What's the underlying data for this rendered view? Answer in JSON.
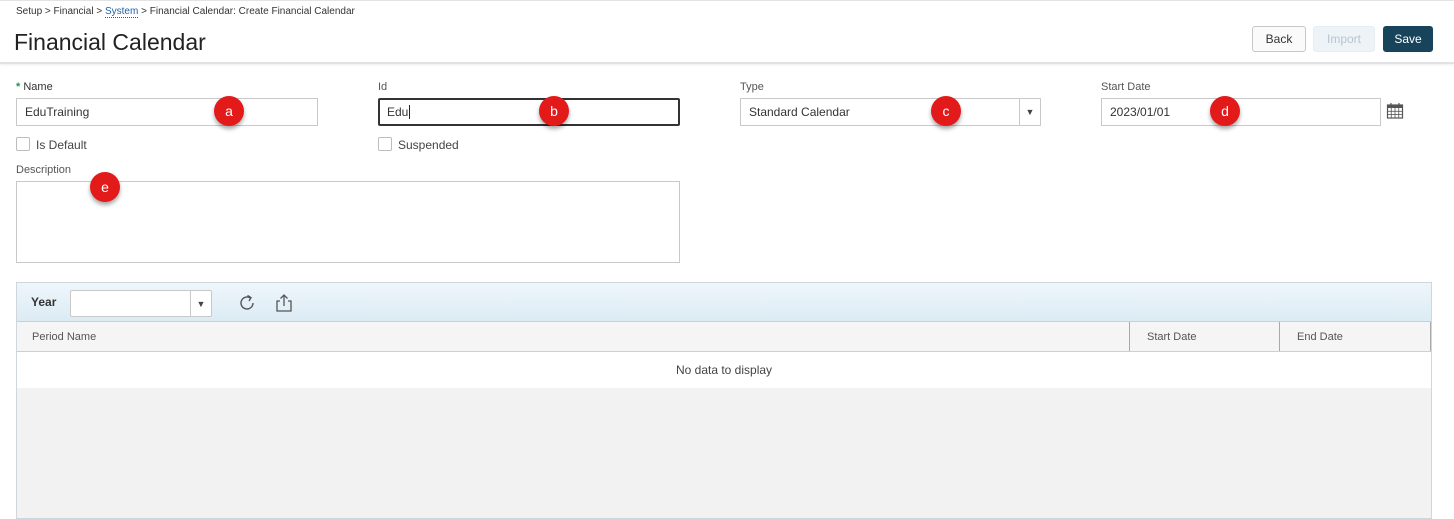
{
  "breadcrumb": {
    "items": [
      "Setup",
      "Financial",
      "System",
      "Financial Calendar: Create Financial Calendar"
    ],
    "separator": ">"
  },
  "page": {
    "title": "Financial Calendar"
  },
  "actions": {
    "back": "Back",
    "import": "Import",
    "save": "Save"
  },
  "form": {
    "name": {
      "required_marker": "*",
      "label": "Name",
      "value": "EduTraining"
    },
    "id": {
      "label": "Id",
      "value": "Edu"
    },
    "type": {
      "label": "Type",
      "value": "Standard Calendar"
    },
    "start_date": {
      "label": "Start Date",
      "value": "2023/01/01"
    },
    "is_default": {
      "label": "Is Default",
      "checked": false
    },
    "suspended": {
      "label": "Suspended",
      "checked": false
    },
    "description": {
      "label": "Description",
      "value": ""
    }
  },
  "callouts": {
    "a": "a",
    "b": "b",
    "c": "c",
    "d": "d",
    "e": "e"
  },
  "grid": {
    "year_label": "Year",
    "year_value": "",
    "columns": [
      "Period Name",
      "Start Date",
      "End Date"
    ],
    "empty_message": "No data to display"
  },
  "colors": {
    "callout": "#e21a1a",
    "save_button": "#17445a",
    "link": "#1f5fa8",
    "required_marker": "#2e8b57"
  },
  "icons": [
    "calendar-icon",
    "chevron-down-icon",
    "refresh-icon",
    "export-icon"
  ]
}
